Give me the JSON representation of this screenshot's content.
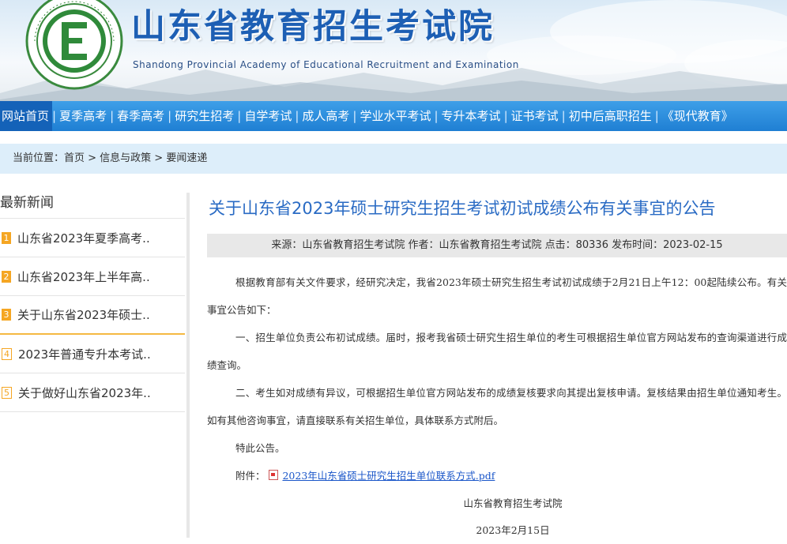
{
  "header": {
    "title": "山东省教育招生考试院",
    "subtitle": "Shandong Provincial Academy of Educational Recruitment and Examination",
    "logo_letter": "E"
  },
  "nav": {
    "items": [
      "网站首页",
      "夏季高考",
      "春季高考",
      "研究生招考",
      "自学考试",
      "成人高考",
      "学业水平考试",
      "专升本考试",
      "证书考试",
      "初中后高职招生",
      "《现代教育》"
    ],
    "separator": "|"
  },
  "breadcrumb": {
    "text": "当前位置：首页 > 信息与政策 > 要闻速递"
  },
  "sidebar": {
    "title": "最新新闻",
    "items": [
      {
        "num": "1",
        "text": "山东省2023年夏季高考.."
      },
      {
        "num": "2",
        "text": "山东省2023年上半年高.."
      },
      {
        "num": "3",
        "text": "关于山东省2023年硕士.."
      },
      {
        "num": "4",
        "text": "2023年普通专升本考试.."
      },
      {
        "num": "5",
        "text": "关于做好山东省2023年.."
      }
    ]
  },
  "article": {
    "title": "关于山东省2023年硕士研究生招生考试初试成绩公布有关事宜的公告",
    "meta": "来源：山东省教育招生考试院 作者：山东省教育招生考试院 点击：80336 发布时间：2023-02-15",
    "p1": "根据教育部有关文件要求，经研究决定，我省2023年硕士研究生招生考试初试成绩于2月21日上午12：00起陆续公布。有关事宜公告如下：",
    "p2": "一、招生单位负责公布初试成绩。届时，报考我省硕士研究生招生单位的考生可根据招生单位官方网站发布的查询渠道进行成绩查询。",
    "p3": "二、考生如对成绩有异议，可根据招生单位官方网站发布的成绩复核要求向其提出复核申请。复核结果由招生单位通知考生。如有其他咨询事宜，请直接联系有关招生单位，具体联系方式附后。",
    "p4": "特此公告。",
    "attach_label": "附件：",
    "attach_link": "2023年山东省硕士研究生招生单位联系方式.pdf",
    "sign_org": "山东省教育招生考试院",
    "sign_date": "2023年2月15日"
  }
}
